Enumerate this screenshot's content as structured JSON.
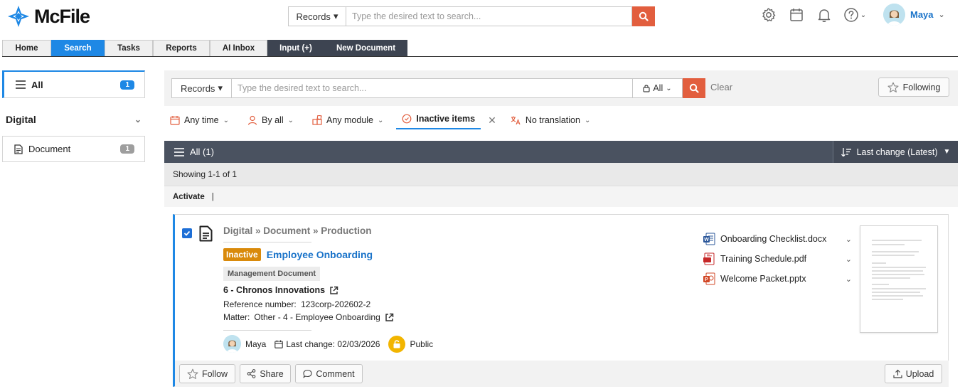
{
  "app": {
    "logo_text": "McFile",
    "brand_color": "#1e88e5",
    "accent_color": "#e25e3e"
  },
  "header": {
    "search": {
      "scope_label": "Records",
      "placeholder": "Type the desired text to search..."
    },
    "icons": [
      "gear-icon",
      "calendar-icon",
      "bell-icon",
      "help-icon"
    ],
    "user_name": "Maya"
  },
  "nav": {
    "tabs": [
      "Home",
      "Search",
      "Tasks",
      "Reports",
      "AI Inbox",
      "Input (+)",
      "New Document"
    ],
    "active_tab": "Search"
  },
  "sidebar": {
    "all": {
      "label": "All",
      "count": "1"
    },
    "group": {
      "label": "Digital"
    },
    "items": [
      {
        "label": "Document",
        "count": "1"
      }
    ]
  },
  "filter": {
    "search": {
      "scope_label": "Records",
      "placeholder": "Type the desired text to search...",
      "access_label": "All"
    },
    "clear_label": "Clear",
    "following_label": "Following",
    "chips": {
      "time": "Any time",
      "by": "By all",
      "module": "Any module",
      "inactive": "Inactive items",
      "translation": "No translation"
    }
  },
  "results": {
    "header_label": "All (1)",
    "sort_label": "Last change (Latest)",
    "showing": "Showing 1-1 of 1",
    "bulk_action": "Activate",
    "bulk_separator": "|"
  },
  "record": {
    "selected": true,
    "breadcrumb": "Digital » Document » Production",
    "status": "Inactive",
    "title": "Employee Onboarding",
    "type": "Management Document",
    "client": "6 - Chronos Innovations",
    "reference_label": "Reference number:",
    "reference_value": "123corp-202602-2",
    "matter_label": "Matter:",
    "matter_value": "Other - 4 - Employee Onboarding",
    "owner": "Maya",
    "last_change": "Last change: 02/03/2026",
    "visibility": "Public",
    "files": [
      {
        "name": "Onboarding Checklist.docx",
        "icon": "word-icon",
        "color": "#2b579a"
      },
      {
        "name": "Training Schedule.pdf",
        "icon": "pdf-icon",
        "color": "#c62828"
      },
      {
        "name": "Welcome Packet.pptx",
        "icon": "powerpoint-icon",
        "color": "#d24726"
      }
    ],
    "actions": {
      "follow": "Follow",
      "share": "Share",
      "comment": "Comment",
      "upload": "Upload"
    }
  }
}
